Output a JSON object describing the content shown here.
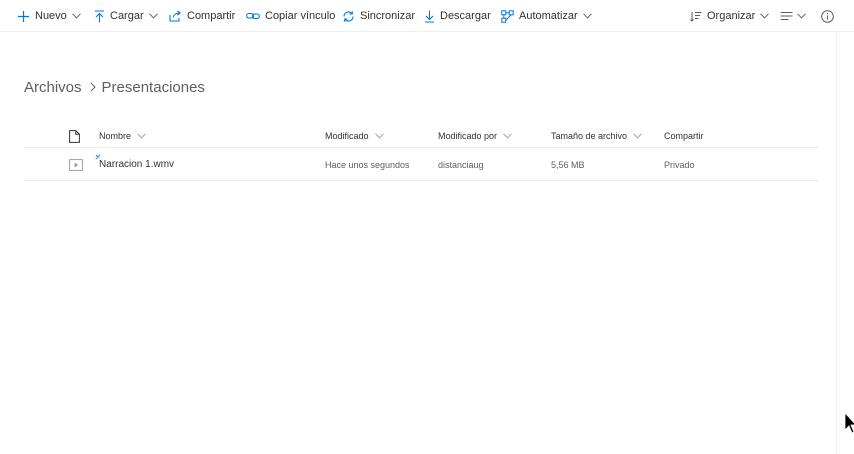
{
  "commandbar": {
    "new_label": "Nuevo",
    "upload_label": "Cargar",
    "share_label": "Compartir",
    "copy_link_label": "Copiar vínculo",
    "sync_label": "Sincronizar",
    "download_label": "Descargar",
    "automate_label": "Automatizar",
    "sort_label": "Organizar"
  },
  "breadcrumb": {
    "root": "Archivos",
    "current": "Presentaciones"
  },
  "list": {
    "columns": {
      "name": "Nombre",
      "modified": "Modificado",
      "modified_by": "Modificado por",
      "file_size": "Tamaño de archivo",
      "sharing": "Compartir"
    },
    "rows": [
      {
        "name": "Narracion 1.wmv",
        "modified": "Hace unos segundos",
        "modified_by": "distanciaug",
        "file_size": "5,56 MB",
        "sharing": "Privado"
      }
    ]
  },
  "icons": {
    "new": "plus-icon",
    "upload": "upload-arrow-icon",
    "share": "share-icon",
    "copy_link": "link-icon",
    "sync": "sync-icon",
    "download": "download-arrow-icon",
    "automate": "flow-icon",
    "sort": "sort-icon",
    "view": "view-options-icon",
    "info": "info-icon",
    "file_header": "document-icon",
    "file_row": "video-file-icon",
    "new_item": "new-item-sparkle-icon"
  },
  "colors": {
    "accent": "#0078d4",
    "text": "#323130",
    "secondary_text": "#605e5c",
    "divider": "#edebe9"
  }
}
